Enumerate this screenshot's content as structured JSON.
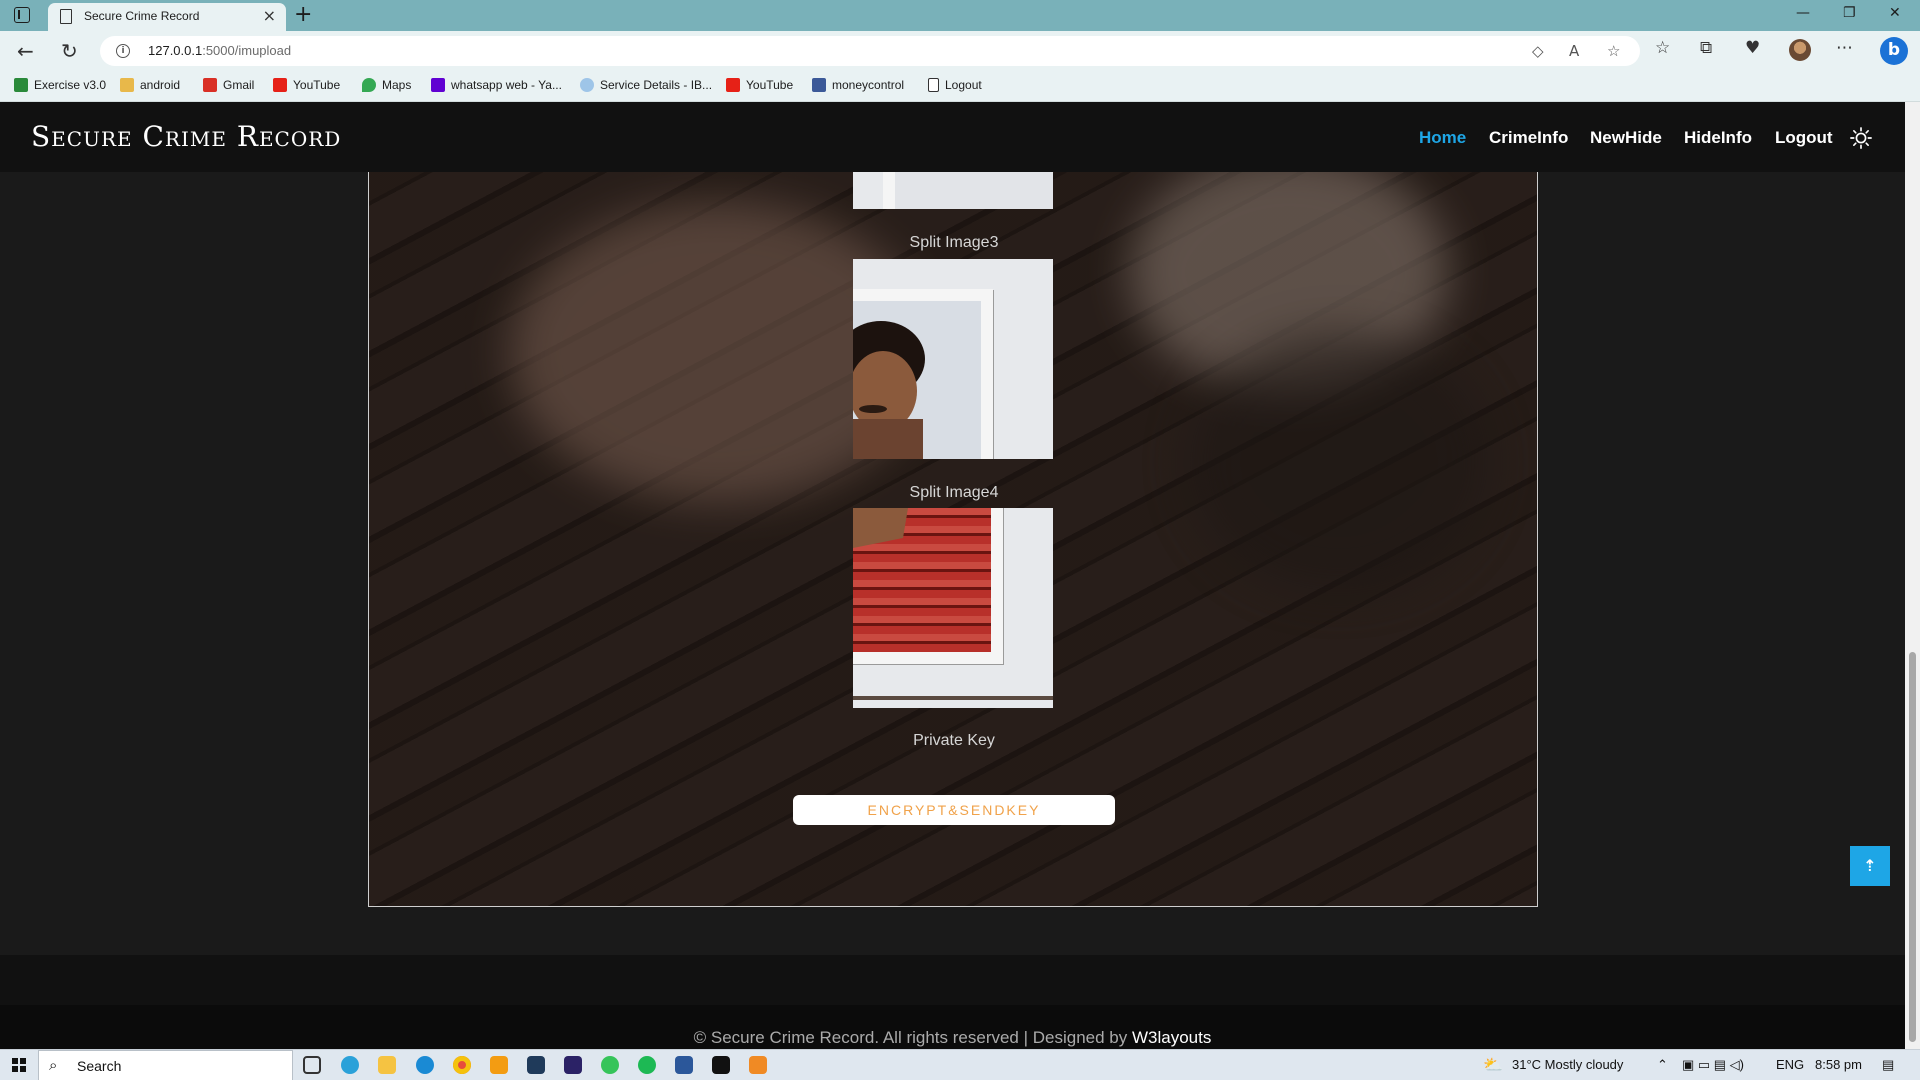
{
  "browser": {
    "tab_title": "Secure Crime Record",
    "new_tab": "+",
    "url_host": "127.0.0.1",
    "url_path": ":5000/imupload",
    "bookmarks": [
      {
        "label": "Exercise v3.0",
        "color": "#2a8a3a"
      },
      {
        "label": "android",
        "color": "#e8b84a"
      },
      {
        "label": "Gmail",
        "color": "#d93025"
      },
      {
        "label": "YouTube",
        "color": "#e62117"
      },
      {
        "label": "Maps",
        "color": "#34a853"
      },
      {
        "label": "whatsapp web - Ya...",
        "color": "#6001d2"
      },
      {
        "label": "Service Details - IB...",
        "color": "#9ec5e8"
      },
      {
        "label": "YouTube",
        "color": "#e62117"
      },
      {
        "label": "moneycontrol",
        "color": "#3b5998"
      },
      {
        "label": "Logout",
        "color": "#ffffff"
      }
    ]
  },
  "site": {
    "brand": "Secure Crime Record",
    "nav": [
      "Home",
      "CrimeInfo",
      "NewHide",
      "HideInfo",
      "Logout"
    ],
    "active_nav": "Home",
    "accent": "#1ea6e6"
  },
  "content": {
    "captions": [
      "Split Image3",
      "Split Image4",
      "Private Key"
    ],
    "encrypt_button": "ENCRYPT&SENDKEY",
    "button_text_color": "#f0a24a"
  },
  "footer": {
    "copyright": "© Secure Crime Record. All rights reserved | Designed by ",
    "designer": "W3layouts",
    "to_top": "⇡"
  },
  "taskbar": {
    "search": "Search",
    "weather": "31°C  Mostly cloudy",
    "lang": "ENG",
    "time": "8:58 pm"
  }
}
